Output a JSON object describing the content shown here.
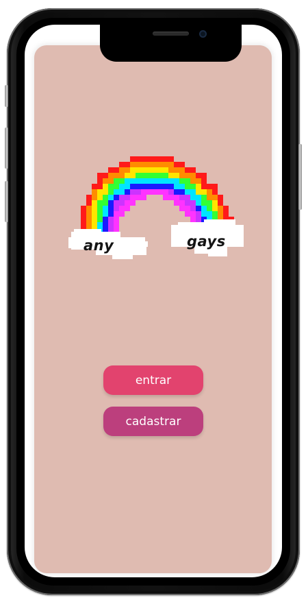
{
  "logo": {
    "word_left": "any",
    "word_right": "gays",
    "colors": [
      "#ff1a1a",
      "#ff8c00",
      "#ffe600",
      "#33ff33",
      "#00e5ff",
      "#1a1aff",
      "#cc33ff",
      "#ff33ff"
    ]
  },
  "actions": {
    "login_label": "entrar",
    "signup_label": "cadastrar",
    "login_color": "#e2436e",
    "signup_color": "#bc3f7d"
  },
  "app": {
    "background": "#dfbbb1"
  }
}
